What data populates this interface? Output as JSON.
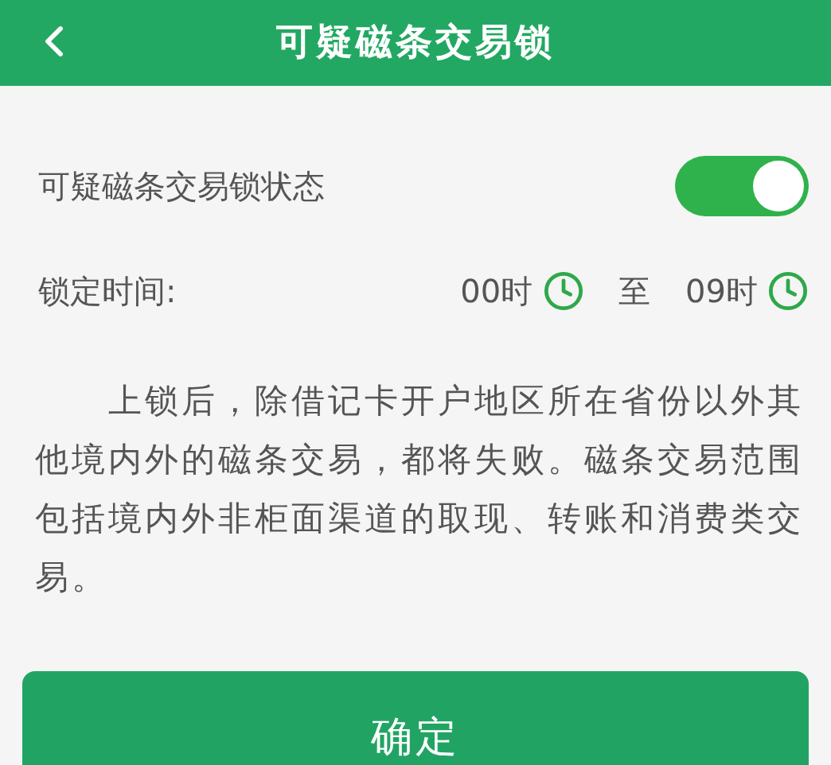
{
  "header": {
    "title": "可疑磁条交易锁"
  },
  "lock_status": {
    "label": "可疑磁条交易锁状态",
    "on": true
  },
  "lock_time": {
    "label": "锁定时间:",
    "start": "00时",
    "separator": "至",
    "end": "09时"
  },
  "description": "上锁后，除借记卡开户地区所在省份以外其他境内外的磁条交易，都将失败。磁条交易范围包括境内外非柜面渠道的取现、转账和消费类交易。",
  "confirm_button": "确定"
}
